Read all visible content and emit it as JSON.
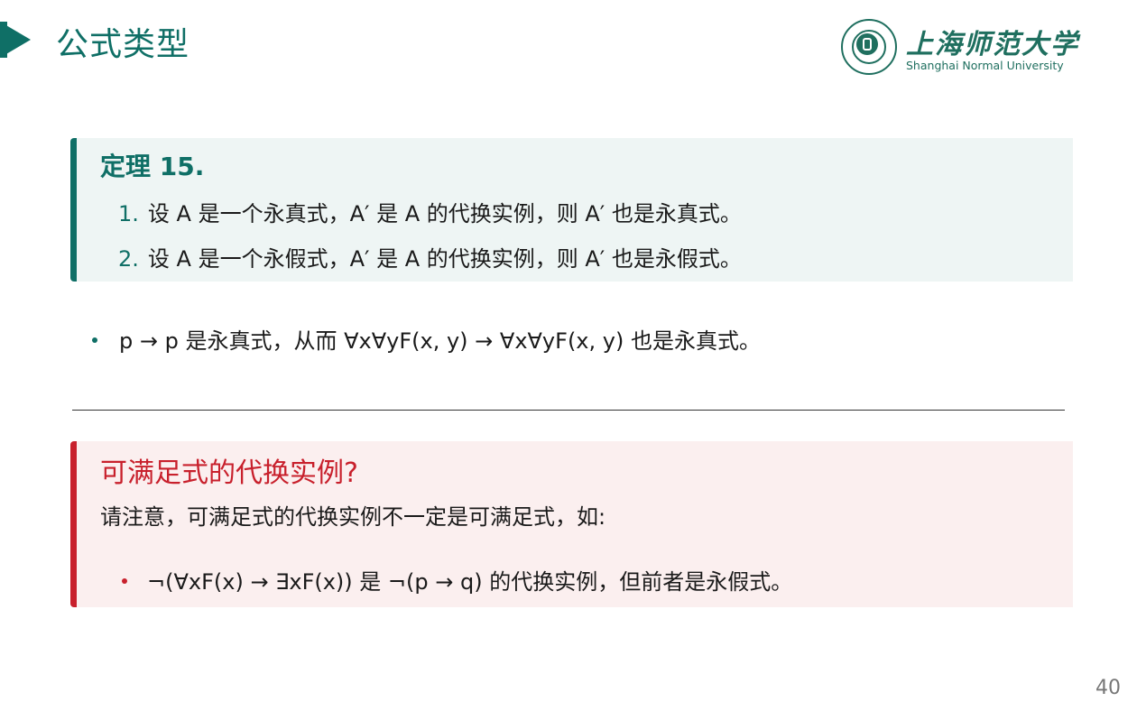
{
  "slide": {
    "title": "公式类型",
    "page_number": "40"
  },
  "logo": {
    "name_cn": "上海师范大学",
    "name_en": "Shanghai Normal University",
    "seal_text": "上海师范大学 SHANGHAI NORMAL UNIVERSITY"
  },
  "theorem": {
    "title": "定理 15.",
    "items": [
      {
        "num": "1.",
        "text": "设 A 是一个永真式，A′ 是 A 的代换实例，则 A′ 也是永真式。"
      },
      {
        "num": "2.",
        "text": "设 A 是一个永假式，A′ 是 A 的代换实例，则 A′ 也是永假式。"
      }
    ]
  },
  "bullet": {
    "text": "p → p 是永真式，从而 ∀x∀yF(x, y) → ∀x∀yF(x, y) 也是永真式。"
  },
  "alert": {
    "title": "可满足式的代换实例?",
    "text": "请注意，可满足式的代换实例不一定是可满足式，如:",
    "bullet": "¬(∀xF(x) → ∃xF(x)) 是 ¬(p → q) 的代换实例，但前者是永假式。"
  },
  "colors": {
    "accent": "#0f6f66",
    "alert": "#c8202c",
    "theorem_bg": "#eef5f4",
    "alert_bg": "#fbefef"
  }
}
